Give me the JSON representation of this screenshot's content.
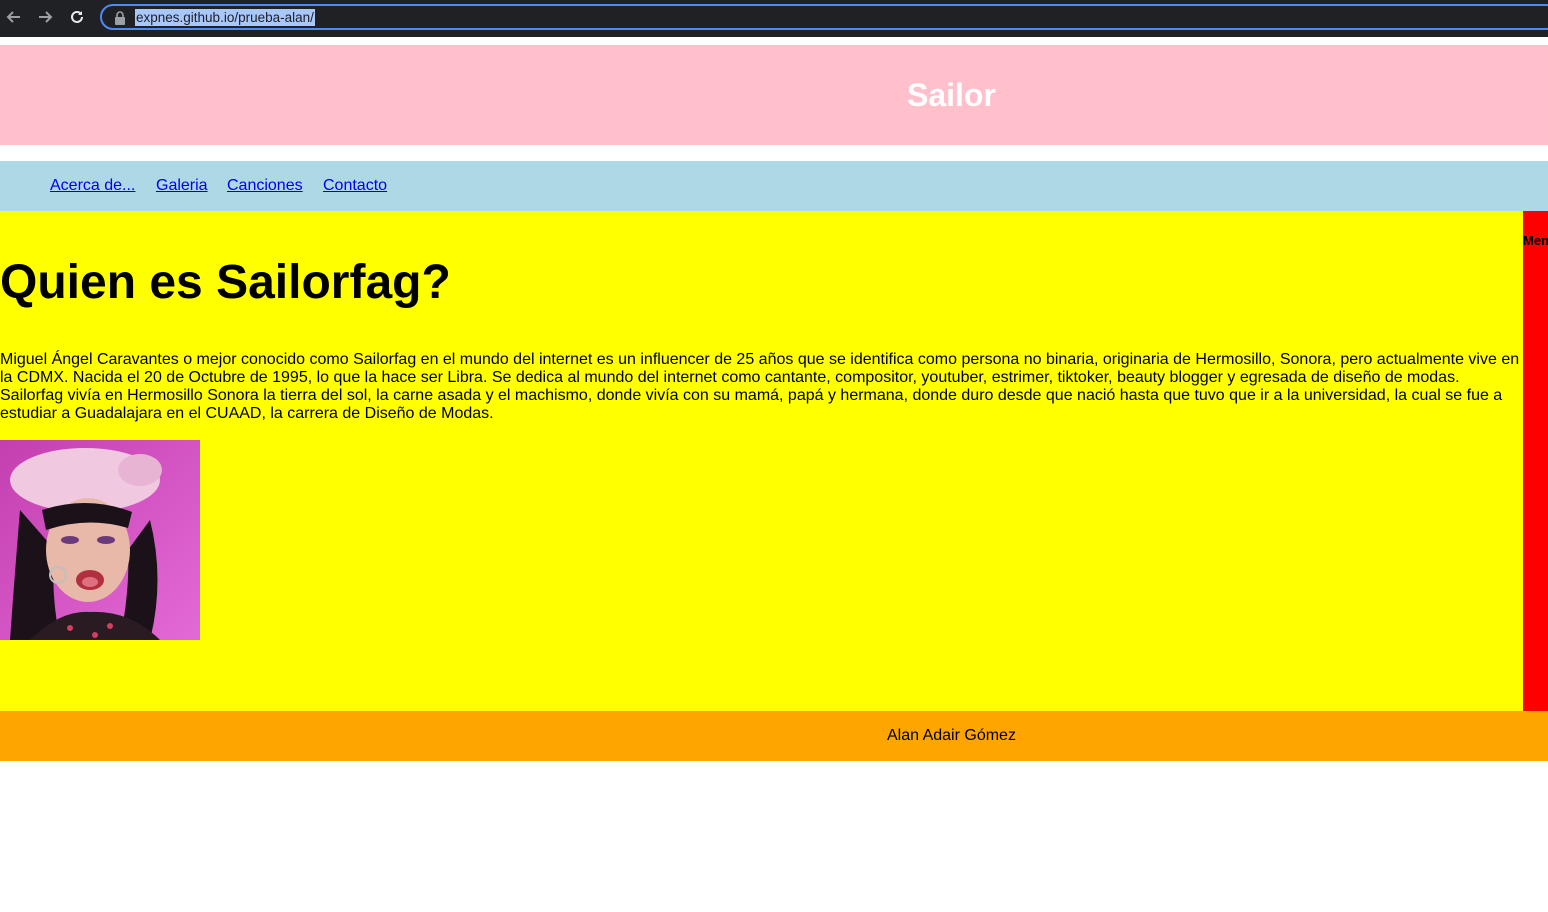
{
  "browser": {
    "url": "expnes.github.io/prueba-alan/",
    "omnibox_border_color": "#4c8bf5",
    "chrome_color": "#202124"
  },
  "header": {
    "title": "Sailor",
    "background": "#ffc0cb"
  },
  "nav": {
    "background": "#add8e6",
    "items": [
      {
        "label": "Acerca de..."
      },
      {
        "label": "Galeria"
      },
      {
        "label": "Canciones"
      },
      {
        "label": "Contacto"
      }
    ]
  },
  "main": {
    "background": "#ffff00",
    "heading": "Quien es Sailorfag?",
    "bio": "Miguel Ángel Caravantes o mejor conocido como Sailorfag en el mundo del internet es un influencer de 25 años que se identifica como persona no binaria, originaria de Hermosillo, Sonora, pero actualmente vive en la CDMX. Nacida el 20 de Octubre de 1995, lo que la hace ser Libra. Se dedica al mundo del internet como cantante, compositor, youtuber, estrimer, tiktoker, beauty blogger y egresada de diseño de modas. Sailorfag vivía en Hermosillo Sonora la tierra del sol, la carne asada y el machismo, donde vivía con su mamá, papá y hermana, donde duro desde que nació hasta que tuvo que ir a la universidad, la cual se fue a estudiar a Guadalajara en el CUAAD, la carrera de Diseño de Modas."
  },
  "aside": {
    "background": "#ff0000",
    "title": "Men"
  },
  "footer": {
    "background": "#ffa500",
    "text": "Alan Adair Gómez"
  }
}
